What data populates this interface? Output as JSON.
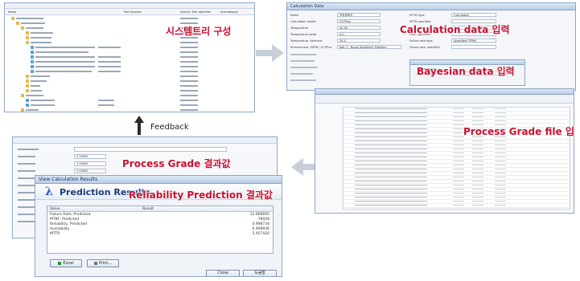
{
  "captions": {
    "system_tree": "시스템트리 구성",
    "calculation_data": "Calculation data 입력",
    "bayesian_data": "Bayesian data 입력",
    "process_grade_file": "Process Grade file 입력",
    "process_grade_result": "Process Grade 결과값",
    "reliability_prediction": "Reliability Prediction 결과값",
    "feedback": "Feedback"
  },
  "tree_window": {
    "columns": [
      "Name",
      "Part Number",
      "System Tree Identifier",
      "Subcategory"
    ]
  },
  "calc_window": {
    "title": "Calculation Data",
    "fields": [
      {
        "label": "Name",
        "value": "공업유용성"
      },
      {
        "label": "Calculation model",
        "value": "217Plus"
      },
      {
        "label": "Temperature",
        "value": "40.00"
      },
      {
        "label": "Temperature delta",
        "value": "0.0"
      },
      {
        "label": "Temperature, dormant",
        "value": "25.0"
      },
      {
        "label": "Environment, MFPR / 217Plus",
        "value": "NAL 1 - Naval Sheltered, Platform"
      }
    ],
    "right_fields": [
      {
        "label": "MTTR type",
        "value": "Calculated"
      },
      {
        "label": "MTTR specified",
        "value": ""
      },
      {
        "label": "Duty cycle",
        "value": ""
      },
      {
        "label": "Cost, specified",
        "value": ""
      },
      {
        "label": "Failure rate type",
        "value": "Specified, FPMH"
      },
      {
        "label": "Failure rate, specified",
        "value": ""
      }
    ]
  },
  "results_window": {
    "title": "View Calculation Results",
    "heading": "Prediction Results",
    "columns": [
      "Value",
      "Result"
    ],
    "rows": [
      {
        "label": "Failure Rate, Predicted",
        "value": "12.669695"
      },
      {
        "label": "MTBF, Predicted",
        "value": "78928"
      },
      {
        "label": "Reliability, Predicted",
        "value": "0.998734"
      },
      {
        "label": "Availability",
        "value": "0.999936"
      },
      {
        "label": "MTTR",
        "value": "5.057420"
      }
    ],
    "buttons": {
      "excel": "Excel",
      "print": "Print...",
      "close": "Close",
      "help": "도움말"
    }
  },
  "grade_window": {
    "rows": [
      "0.10000",
      "1.00000",
      "1.00000",
      "1.00000"
    ]
  },
  "colors": {
    "caption": "#c8102e",
    "arrow": "#c9cfd8",
    "results_heading": "#1f3a7a",
    "results_heading_icon": "#2a55c4"
  }
}
